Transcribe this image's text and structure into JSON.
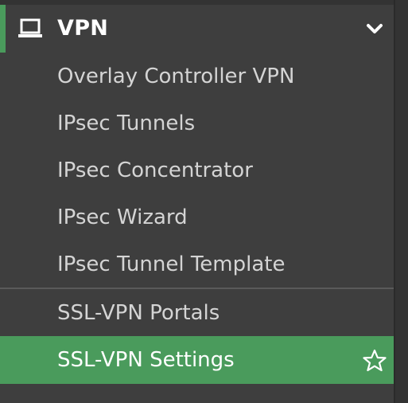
{
  "section": {
    "title": "VPN",
    "icon": "laptop-icon",
    "expanded_icon": "chevron-down-icon",
    "accent_color": "#4a9b5c"
  },
  "items_group1": [
    {
      "label": "Overlay Controller VPN"
    },
    {
      "label": "IPsec Tunnels"
    },
    {
      "label": "IPsec Concentrator"
    },
    {
      "label": "IPsec Wizard"
    },
    {
      "label": "IPsec Tunnel Template"
    }
  ],
  "items_group2": [
    {
      "label": "SSL-VPN Portals"
    },
    {
      "label": "SSL-VPN Settings",
      "active": true,
      "favorite_icon": "star-outline-icon"
    }
  ],
  "colors": {
    "sidebar_bg": "#3e3e3e",
    "active_bg": "#4a9b5c",
    "text": "#d4d4d4"
  }
}
